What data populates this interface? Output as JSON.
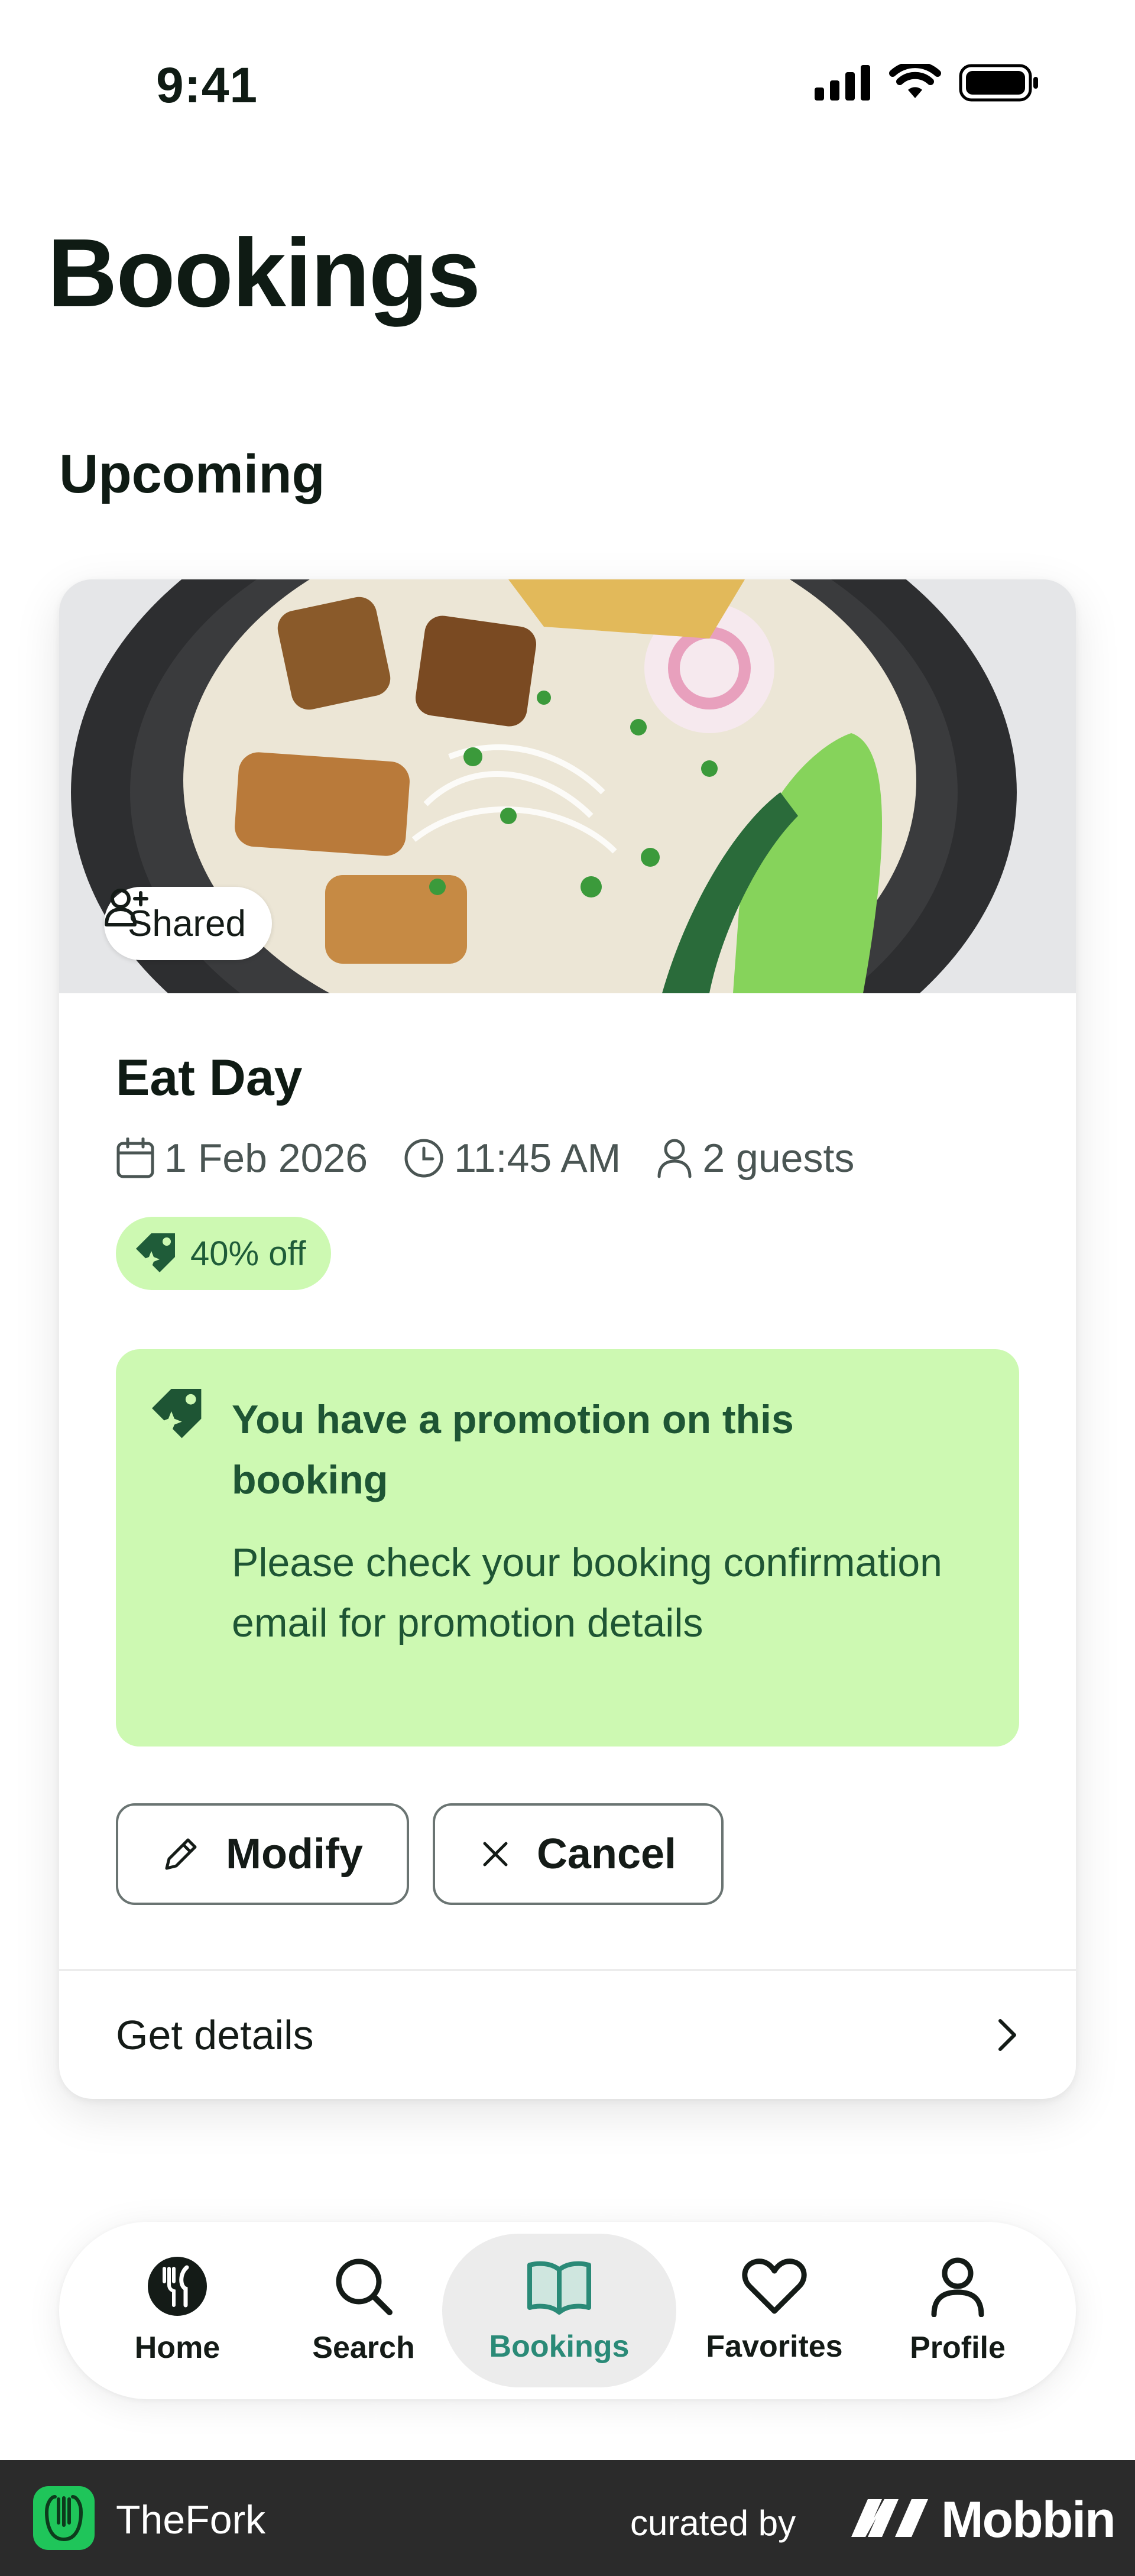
{
  "status_bar": {
    "time": "9:41"
  },
  "page": {
    "title": "Bookings",
    "section": "Upcoming"
  },
  "booking": {
    "shared_label": "Shared",
    "restaurant": "Eat Day",
    "date": "1 Feb 2026",
    "time": "11:45 AM",
    "guests": "2 guests",
    "discount": "40% off",
    "promo_title": "You have a promotion on this booking",
    "promo_body": "Please check your booking confirmation email for promotion details",
    "modify_label": "Modify",
    "cancel_label": "Cancel",
    "details_label": "Get details"
  },
  "tabbar": {
    "items": [
      {
        "label": "Home",
        "icon": "fork-knife-icon"
      },
      {
        "label": "Search",
        "icon": "search-icon"
      },
      {
        "label": "Bookings",
        "icon": "book-icon",
        "active": true
      },
      {
        "label": "Favorites",
        "icon": "heart-icon"
      },
      {
        "label": "Profile",
        "icon": "person-icon"
      }
    ]
  },
  "footer": {
    "app_name": "TheFork",
    "curated_by": "curated by",
    "source": "Mobbin"
  },
  "colors": {
    "accent": "#2a8a77",
    "promo_bg": "#cdf9b2",
    "promo_text": "#1e5534",
    "footer_bg": "#2b2b2b"
  }
}
